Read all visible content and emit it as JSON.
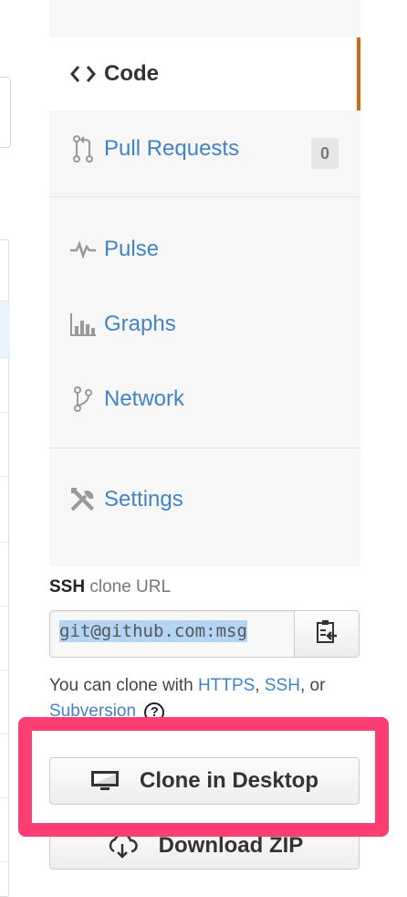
{
  "sidebar": {
    "items": [
      {
        "label": "Code",
        "icon": "code-icon",
        "selected": true
      },
      {
        "label": "Pull Requests",
        "icon": "pull-request-icon",
        "count": "0"
      },
      {
        "label": "Pulse",
        "icon": "pulse-icon"
      },
      {
        "label": "Graphs",
        "icon": "graph-icon"
      },
      {
        "label": "Network",
        "icon": "network-icon"
      },
      {
        "label": "Settings",
        "icon": "tools-icon"
      }
    ]
  },
  "clone": {
    "protocol": "SSH",
    "title_suffix": "clone URL",
    "url": "git@github.com:msg",
    "help_prefix": "You can clone with",
    "link_https": "HTTPS",
    "link_ssh": "SSH",
    "link_svn": "Subversion",
    "sep_comma": ",",
    "sep_or": ", or",
    "help_icon": "?"
  },
  "buttons": {
    "clone_desktop": "Clone in Desktop",
    "download_zip": "Download ZIP"
  },
  "colors": {
    "accent_selected": "#d26911",
    "link": "#4183c4",
    "highlight": "#fb3e74"
  }
}
